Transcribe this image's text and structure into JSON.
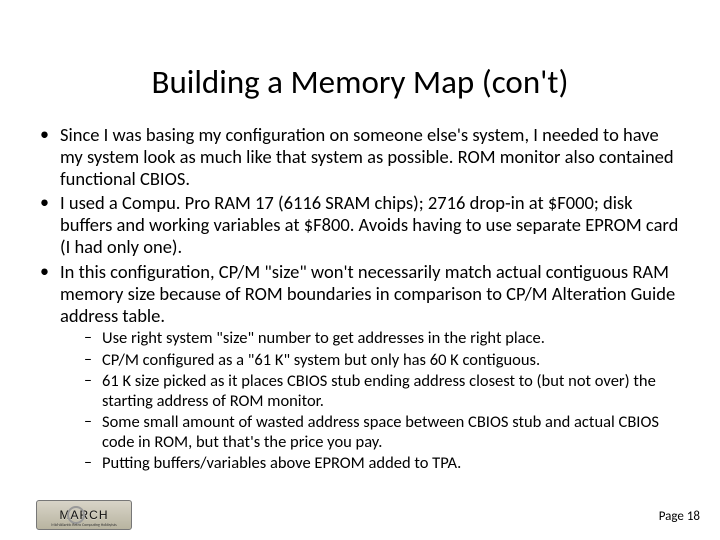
{
  "title": "Building a Memory Map (con't)",
  "bullets": {
    "b1": "Since I was basing my configuration on someone else's system, I needed to have my system look as much like that system as possible. ROM monitor also contained functional CBIOS.",
    "b2": "I used a Compu. Pro RAM 17 (6116 SRAM chips); 2716 drop-in at $F000; disk buffers and working variables at $F800. Avoids having to use separate EPROM card (I had only one).",
    "b3": "In this configuration, CP/M \"size\" won't necessarily match actual contiguous RAM memory size because of ROM boundaries in comparison to CP/M Alteration Guide address table."
  },
  "sub": {
    "s1": "Use right system \"size\" number to get addresses in the right place.",
    "s2": "CP/M configured as a \"61 K\" system but only has 60 K contiguous.",
    "s3": "61 K size picked as it places CBIOS stub ending address closest to (but not over) the starting address of ROM monitor.",
    "s4": "Some small amount of wasted address space between CBIOS stub and actual CBIOS code in ROM, but that's the price you pay.",
    "s5": "Putting buffers/variables above EPROM added to TPA."
  },
  "footer": "Page 18",
  "logo": {
    "text": "MARCH",
    "subtitle": "Mid-Atlantic Retro Computing Hobbyists"
  }
}
